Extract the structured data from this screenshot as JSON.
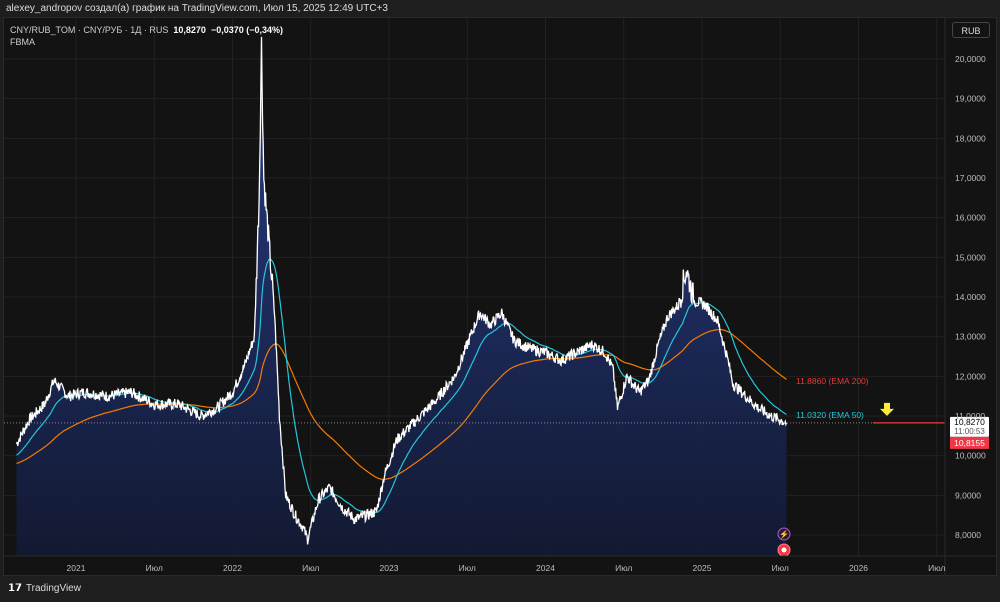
{
  "header": {
    "caption": "alexey_andropov создал(а) график на TradingView.com, Июл 15, 2025 12:49 UTC+3"
  },
  "legend": {
    "symbol": "CNY/RUB_TOM · CNY/РУБ · 1Д · RUS",
    "last": "10,8270",
    "change": "−0,0370 (−0,34%)",
    "indicator": "FBMA"
  },
  "currency_button": "RUB",
  "footer": {
    "brand": "TradingView",
    "logo_mark": "TV"
  },
  "price_labels": {
    "last_price": "10,8270",
    "countdown": "11:00:53",
    "alert_price": "10,8155"
  },
  "ema_labels": {
    "ema200": "11.8860 (EMA 200)",
    "ema50": "11.0320 (EMA 50)"
  },
  "colors": {
    "price": "#ffffff",
    "ema50": "#26c6da",
    "ema200": "#f57c00",
    "alert": "#f23645",
    "fill": "#1e2a5e",
    "arrow": "#ffeb3b"
  },
  "chart_data": {
    "type": "line",
    "title": "CNY/RUB_TOM · 1Д",
    "x_range": [
      2020.6,
      2026.75
    ],
    "ylim": [
      7.6,
      20.8
    ],
    "y_ticks": [
      "8,0000",
      "9,0000",
      "10,0000",
      "11,0000",
      "12,0000",
      "13,0000",
      "14,0000",
      "15,0000",
      "16,0000",
      "17,0000",
      "18,0000",
      "19,0000",
      "20,0000"
    ],
    "x_ticks": [
      {
        "t": 2021.0,
        "label": "2021"
      },
      {
        "t": 2021.5,
        "label": "Июл"
      },
      {
        "t": 2022.0,
        "label": "2022"
      },
      {
        "t": 2022.5,
        "label": "Июл"
      },
      {
        "t": 2023.0,
        "label": "2023"
      },
      {
        "t": 2023.5,
        "label": "Июл"
      },
      {
        "t": 2024.0,
        "label": "2024"
      },
      {
        "t": 2024.5,
        "label": "Июл"
      },
      {
        "t": 2025.0,
        "label": "2025"
      },
      {
        "t": 2025.5,
        "label": "Июл"
      },
      {
        "t": 2026.0,
        "label": "2026"
      },
      {
        "t": 2026.5,
        "label": "Июл"
      }
    ],
    "series": [
      {
        "name": "CNY/RUB_TOM",
        "points": [
          [
            2020.62,
            10.3
          ],
          [
            2020.7,
            10.9
          ],
          [
            2020.8,
            11.3
          ],
          [
            2020.86,
            11.9
          ],
          [
            2020.95,
            11.5
          ],
          [
            2021.05,
            11.6
          ],
          [
            2021.2,
            11.5
          ],
          [
            2021.35,
            11.6
          ],
          [
            2021.5,
            11.3
          ],
          [
            2021.65,
            11.3
          ],
          [
            2021.8,
            11.0
          ],
          [
            2021.9,
            11.2
          ],
          [
            2022.0,
            11.6
          ],
          [
            2022.08,
            12.3
          ],
          [
            2022.14,
            13.0
          ],
          [
            2022.17,
            16.5
          ],
          [
            2022.185,
            20.4
          ],
          [
            2022.2,
            17.0
          ],
          [
            2022.23,
            15.5
          ],
          [
            2022.27,
            13.5
          ],
          [
            2022.3,
            11.0
          ],
          [
            2022.34,
            9.0
          ],
          [
            2022.4,
            8.5
          ],
          [
            2022.45,
            8.2
          ],
          [
            2022.48,
            7.9
          ],
          [
            2022.55,
            8.9
          ],
          [
            2022.62,
            9.2
          ],
          [
            2022.7,
            8.7
          ],
          [
            2022.78,
            8.4
          ],
          [
            2022.86,
            8.5
          ],
          [
            2022.92,
            8.6
          ],
          [
            2022.97,
            9.5
          ],
          [
            2023.05,
            10.4
          ],
          [
            2023.15,
            10.8
          ],
          [
            2023.3,
            11.4
          ],
          [
            2023.42,
            12.0
          ],
          [
            2023.5,
            12.8
          ],
          [
            2023.58,
            13.6
          ],
          [
            2023.65,
            13.3
          ],
          [
            2023.72,
            13.6
          ],
          [
            2023.8,
            12.9
          ],
          [
            2023.9,
            12.7
          ],
          [
            2024.0,
            12.6
          ],
          [
            2024.1,
            12.4
          ],
          [
            2024.2,
            12.6
          ],
          [
            2024.3,
            12.8
          ],
          [
            2024.38,
            12.6
          ],
          [
            2024.43,
            12.2
          ],
          [
            2024.46,
            11.2
          ],
          [
            2024.52,
            12.0
          ],
          [
            2024.6,
            11.6
          ],
          [
            2024.66,
            11.9
          ],
          [
            2024.72,
            12.8
          ],
          [
            2024.78,
            13.5
          ],
          [
            2024.85,
            13.8
          ],
          [
            2024.9,
            14.7
          ],
          [
            2024.95,
            13.9
          ],
          [
            2025.02,
            13.8
          ],
          [
            2025.1,
            13.4
          ],
          [
            2025.16,
            12.5
          ],
          [
            2025.2,
            11.8
          ],
          [
            2025.28,
            11.5
          ],
          [
            2025.36,
            11.2
          ],
          [
            2025.44,
            11.0
          ],
          [
            2025.5,
            10.9
          ],
          [
            2025.54,
            10.83
          ]
        ]
      }
    ],
    "ema50_last": 11.032,
    "ema200_last": 11.886,
    "last_price": 10.827,
    "alert_level": 10.8155
  }
}
